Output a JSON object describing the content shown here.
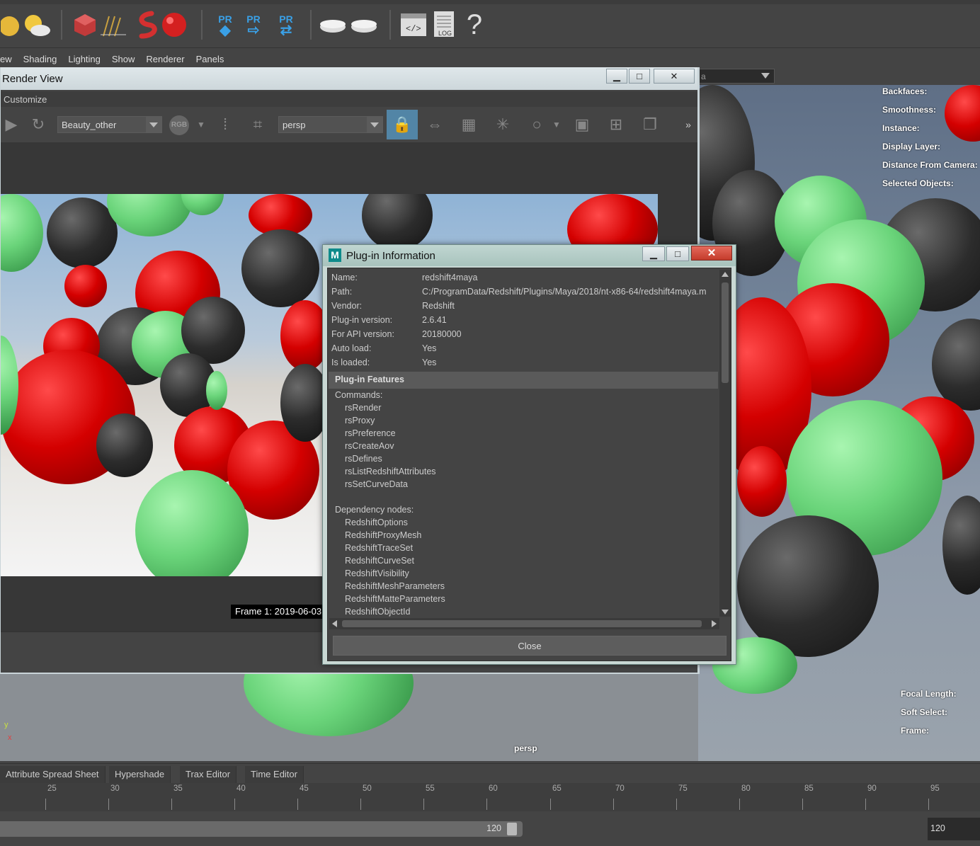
{
  "viewport_menu": [
    "ew",
    "Shading",
    "Lighting",
    "Show",
    "Renderer",
    "Panels"
  ],
  "viewport": {
    "camera_dropdown": "a",
    "hud_top": [
      "Backfaces:",
      "Smoothness:",
      "Instance:",
      "Display Layer:",
      "Distance From Camera:",
      "Selected Objects:"
    ],
    "hud_bottom": [
      "Focal Length:",
      "Soft Select:",
      "Frame:"
    ],
    "camera_name": "persp",
    "axis_y": "y",
    "axis_x": "x"
  },
  "render_view": {
    "title": "Render View",
    "customize": "Customize",
    "layer_combo": "Beauty_other",
    "rgb_label": "RGB",
    "camera_combo": "persp",
    "more": "»",
    "frame_label": "Frame  1:  2019-06-03"
  },
  "dialog": {
    "title": "Plug-in Information",
    "fields": [
      {
        "key": "Name:",
        "value": "redshift4maya"
      },
      {
        "key": "Path:",
        "value": "C:/ProgramData/Redshift/Plugins/Maya/2018/nt-x86-64/redshift4maya.m"
      },
      {
        "key": "Vendor:",
        "value": "Redshift"
      },
      {
        "key": "Plug-in version:",
        "value": "2.6.41"
      },
      {
        "key": "For API version:",
        "value": "20180000"
      },
      {
        "key": "Auto load:",
        "value": "Yes"
      },
      {
        "key": "Is loaded:",
        "value": "Yes"
      }
    ],
    "features_header": "Plug-in Features",
    "commands_label": "Commands:",
    "commands": [
      "rsRender",
      "rsProxy",
      "rsPreference",
      "rsCreateAov",
      "rsDefines",
      "rsListRedshiftAttributes",
      "rsSetCurveData"
    ],
    "nodes_label": "Dependency nodes:",
    "nodes": [
      "RedshiftOptions",
      "RedshiftProxyMesh",
      "RedshiftTraceSet",
      "RedshiftCurveSet",
      "RedshiftVisibility",
      "RedshiftMeshParameters",
      "RedshiftMatteParameters",
      "RedshiftObjectId"
    ],
    "close_label": "Close"
  },
  "panel_tabs": [
    "Attribute Spread Sheet",
    "Hypershade",
    "Trax Editor",
    "Time Editor"
  ],
  "timeline": {
    "ticks": [
      "25",
      "30",
      "35",
      "40",
      "45",
      "50",
      "55",
      "60",
      "65",
      "70",
      "75",
      "80",
      "85",
      "90",
      "95"
    ]
  },
  "range": {
    "end_value": "120",
    "end_field": "120"
  }
}
